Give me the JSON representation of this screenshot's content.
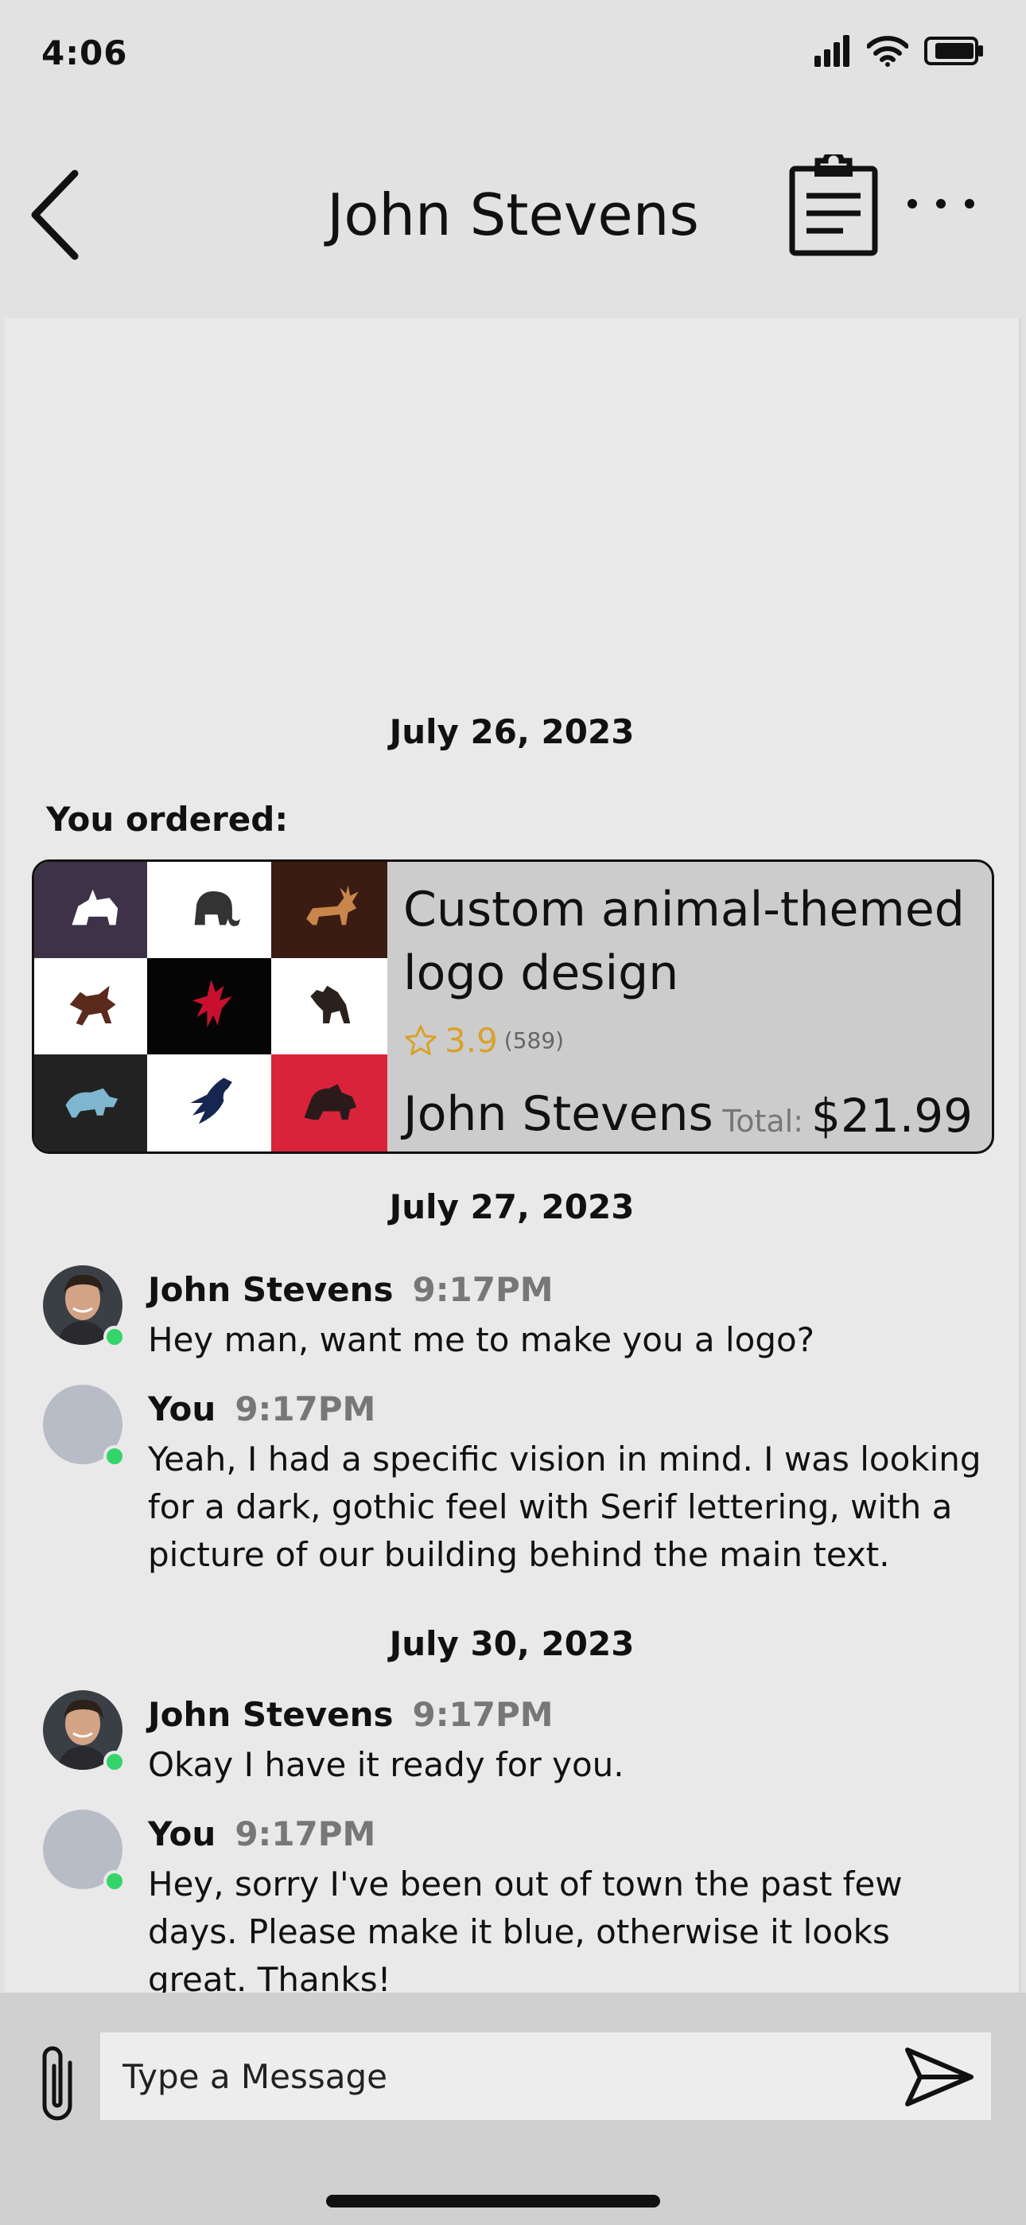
{
  "status_bar": {
    "time": "4:06"
  },
  "header": {
    "title": "John Stevens"
  },
  "chat": {
    "order_date": "July 26, 2023",
    "ordered_label": "You ordered:",
    "order": {
      "title": "Custom animal-themed logo design",
      "rating": "3.9",
      "rating_count": "(589)",
      "seller": "John Stevens",
      "total_label": "Total:",
      "total": "$21.99",
      "thumbnails": [
        {
          "icon": "rhino-icon",
          "bg": "#3d3247",
          "fg": "#ffffff"
        },
        {
          "icon": "mammoth-icon",
          "bg": "#ffffff",
          "fg": "#333333"
        },
        {
          "icon": "stag-icon",
          "bg": "#3b1c12",
          "fg": "#c9864c"
        },
        {
          "icon": "bull-icon",
          "bg": "#ffffff",
          "fg": "#5a2a1c"
        },
        {
          "icon": "phoenix-icon",
          "bg": "#050505",
          "fg": "#c8102e"
        },
        {
          "icon": "bear-icon",
          "bg": "#ffffff",
          "fg": "#2a211d"
        },
        {
          "icon": "wolf-icon",
          "bg": "#222222",
          "fg": "#7fb6d0"
        },
        {
          "icon": "eagle-icon",
          "bg": "#ffffff",
          "fg": "#17264f"
        },
        {
          "icon": "bison-icon",
          "bg": "#d9233b",
          "fg": "#2b1a1a"
        }
      ]
    },
    "groups": [
      {
        "date": "July 27, 2023",
        "messages": [
          {
            "author": "John Stevens",
            "time": "9:17PM",
            "text": "Hey man, want me to make you a logo?"
          },
          {
            "author": "You",
            "time": "9:17PM",
            "text": "Yeah, I had a specific vision in mind. I was looking for a dark, gothic feel with Serif lettering, with a picture of our building behind the main text."
          }
        ]
      },
      {
        "date": "July 30, 2023",
        "messages": [
          {
            "author": "John Stevens",
            "time": "9:17PM",
            "text": "Okay I have it ready for you."
          },
          {
            "author": "You",
            "time": "9:17PM",
            "text": "Hey, sorry I've been out of town the past few days. Please make it blue, otherwise it looks great. Thanks!"
          }
        ]
      }
    ]
  },
  "composer": {
    "placeholder": "Type a Message"
  },
  "colors": {
    "online": "#35d46a",
    "star": "#d9a12a",
    "background": "#e2e2e2",
    "card": "#cccccc"
  }
}
